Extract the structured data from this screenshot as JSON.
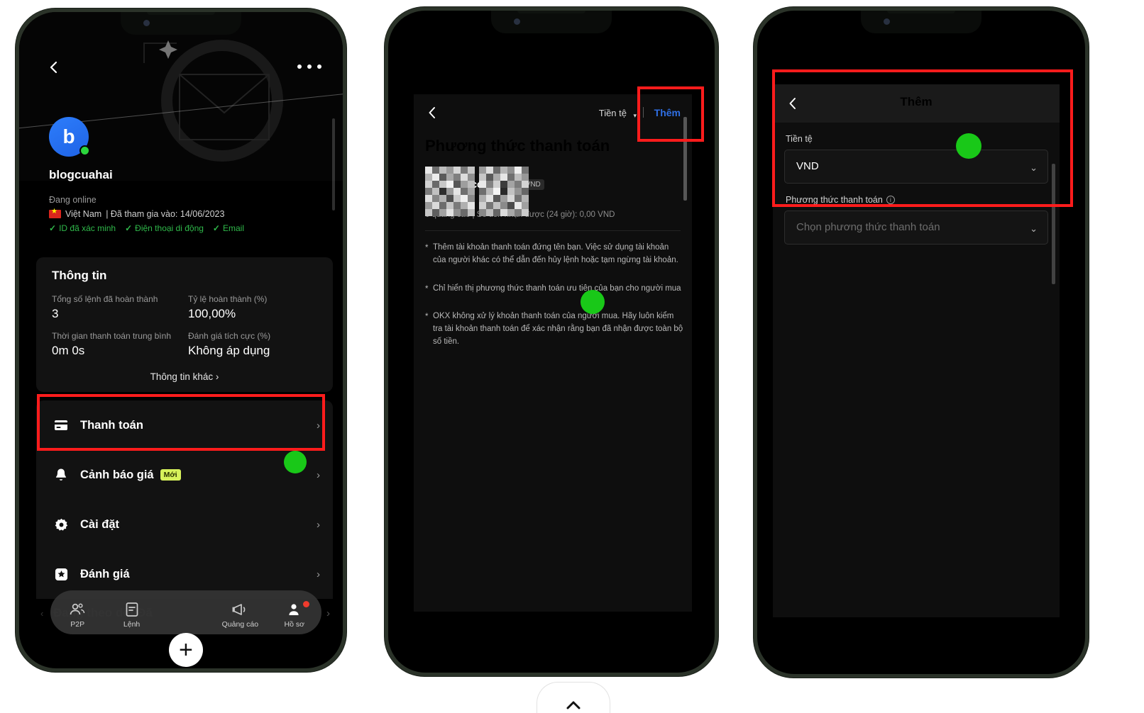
{
  "phone1": {
    "header": {
      "back_icon": "chevron-left-icon",
      "more_icon": "ellipsis-icon"
    },
    "profile": {
      "avatar_letter": "b",
      "username": "blogcuahai",
      "status": "Đang online",
      "country": "Việt Nam",
      "joined": "| Đã tham gia vào: 14/06/2023",
      "badges": [
        "ID đã xác minh",
        "Điện thoại di động",
        "Email"
      ],
      "check_glyph": "✓"
    },
    "info_card": {
      "title": "Thông tin",
      "stats": [
        {
          "label": "Tổng số lệnh đã hoàn thành",
          "value": "3"
        },
        {
          "label": "Tỷ lệ hoàn thành (%)",
          "value": "100,00%"
        },
        {
          "label": "Thời gian thanh toán trung bình",
          "value": "0m 0s"
        },
        {
          "label": "Đánh giá tích cực (%)",
          "value": "Không áp dụng"
        }
      ],
      "more_link": "Thông tin khác",
      "more_chevron": "›"
    },
    "menu": [
      {
        "label": "Thanh toán",
        "icon": "credit-card-icon",
        "badge": "",
        "chevron": "›"
      },
      {
        "label": "Cảnh báo giá",
        "icon": "bell-icon",
        "badge": "Mới",
        "chevron": "›"
      },
      {
        "label": "Cài đặt",
        "icon": "gear-icon",
        "badge": "",
        "chevron": "›"
      },
      {
        "label": "Đánh giá",
        "icon": "star-square-icon",
        "badge": "",
        "chevron": "›"
      }
    ],
    "ghost_row": {
      "label": "Đang theo dõi/Đã",
      "chevron_left": "‹",
      "chevron_right": "›"
    },
    "tabbar": [
      {
        "label": "P2P",
        "icon": "people-icon"
      },
      {
        "label": "Lệnh",
        "icon": "order-list-icon"
      },
      {
        "label": "",
        "icon": "plus-icon"
      },
      {
        "label": "Quảng cáo",
        "icon": "megaphone-icon"
      },
      {
        "label": "Hồ sơ",
        "icon": "person-icon"
      }
    ]
  },
  "phone2": {
    "topbar": {
      "back_icon": "chevron-left-icon",
      "currency_label": "Tiền tệ",
      "currency_caret": "▾",
      "add_label": "Thêm"
    },
    "title": "Phương thức thanh toán",
    "bank": {
      "name_visible": "hàng Vietcombank",
      "tag": "VND",
      "subtitle": "0 quảng cáo  |  Số tiền nhận được (24 giờ): 0,00 VND"
    },
    "notes": [
      "Thêm tài khoản thanh toán đứng tên bạn. Việc sử dụng tài khoản của người khác có thể dẫn đến hủy lệnh hoặc tạm ngừng tài khoản.",
      "Chỉ hiển thị phương thức thanh toán ưu tiên của bạn cho người mua",
      "OKX không xử lý khoản thanh toán của người mua. Hãy luôn kiểm tra tài khoản thanh toán để xác nhận rằng bạn đã nhận được toàn bộ số tiền."
    ]
  },
  "phone3": {
    "bar": {
      "back_icon": "chevron-left-icon",
      "title": "Thêm"
    },
    "currency": {
      "label": "Tiền tệ",
      "value": "VND",
      "chevron": "⌄"
    },
    "method": {
      "label": "Phương thức thanh toán",
      "info_icon": "info-icon",
      "info_glyph": "i",
      "placeholder": "Chọn phương thức thanh toán",
      "chevron": "⌄"
    }
  },
  "colors": {
    "highlight_red": "#ff1c1c",
    "accent_green": "#19c818",
    "link_blue": "#2f6fe4",
    "badge_lime": "#d7f25b",
    "verify_green": "#2fb84a"
  }
}
